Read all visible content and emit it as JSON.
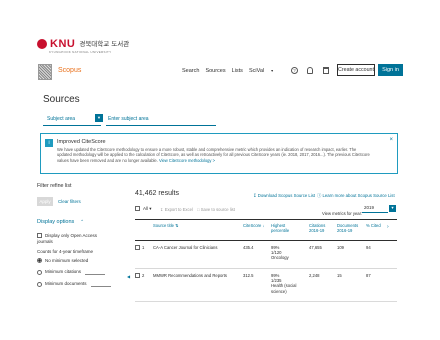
{
  "institution": {
    "name": "KNU",
    "korean_name": "경북대학교 도서관",
    "subtitle": "KYUNGPOOK NATIONAL UNIVERSITY"
  },
  "header": {
    "brand": "Scopus",
    "nav": [
      "Search",
      "Sources",
      "Lists",
      "SciVal"
    ],
    "help_icon": "?",
    "create_account": "Create account",
    "sign_in": "Sign in"
  },
  "page": {
    "title": "Sources",
    "subject_area_label": "Subject area",
    "subject_area_placeholder": "Enter subject area"
  },
  "notice": {
    "icon_label": "i",
    "title": "Improved CiteScore",
    "body": "We have updated the CiteScore methodology to ensure a more robust, stable and comprehensive metric which provides an indication of research impact, earlier. The updated methodology will be applied to the calculation of CiteScore, as well as retroactively for all previous CiteScore years (ie. 2018, 2017, 2016...). The previous CiteScore values have been removed and are no longer available.",
    "link": "View CiteScore methodology >"
  },
  "filters": {
    "title": "Filter refine list",
    "apply": "Apply",
    "clear": "Clear filters",
    "display_options": "Display options",
    "open_access": "Display only Open Access journals",
    "counts_label": "Counts for 4-year timeframe",
    "radio_none": "No minimum selected",
    "radio_citations": "Minimum citations",
    "radio_documents": "Minimum documents"
  },
  "results": {
    "count": "41,462 results",
    "download": "Download Scopus Source List",
    "learn_more": "Learn more about Scopus Source List",
    "all": "All",
    "export": "Export to Excel",
    "save": "Save to source list",
    "view_metrics": "View metrics for year:",
    "year": "2019",
    "columns": {
      "title": "Source title",
      "citescore": "CiteScore",
      "percentile": "Highest percentile",
      "citations": "Citations 2016-19",
      "documents": "Documents 2016-19",
      "cited": "% Cited"
    },
    "rows": [
      {
        "num": "1",
        "title": "CA-A Cancer Journal for Clinicians",
        "citescore": "435.4",
        "percentile": "99%",
        "rank": "1/120",
        "category": "Oncology",
        "citations": "47,655",
        "documents": "109",
        "cited": "94"
      },
      {
        "num": "2",
        "title": "MMWR Recommendations and Reports",
        "citescore": "312.5",
        "percentile": "99%",
        "rank": "1/235",
        "category": "Health (social science)",
        "citations": "2,248",
        "documents": "15",
        "cited": "87"
      }
    ]
  }
}
